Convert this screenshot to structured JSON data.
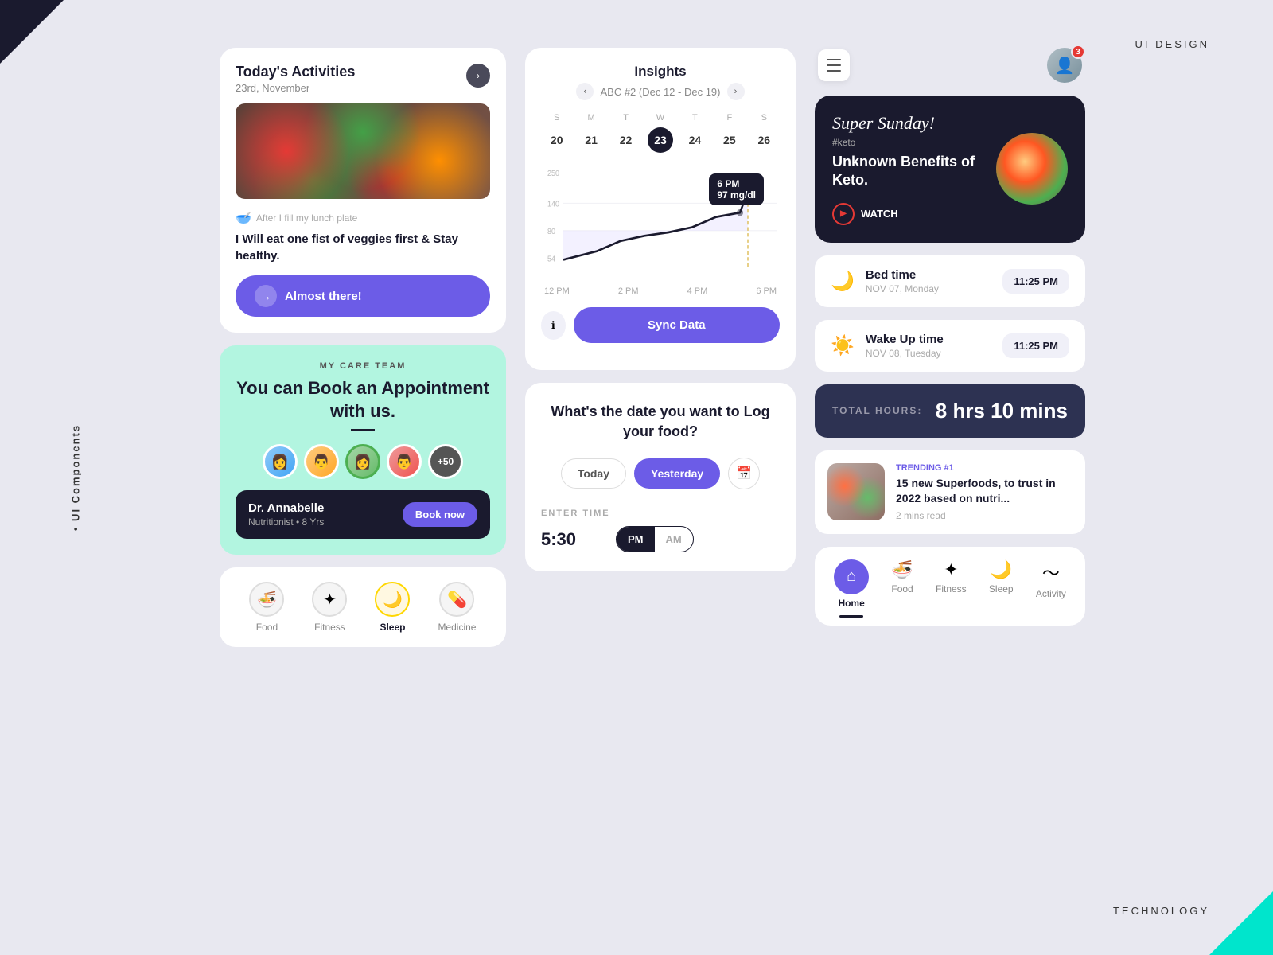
{
  "labels": {
    "ui_design": "UI DESIGN",
    "technology": "TECHNOLOGY",
    "ui_components": "• UI Components"
  },
  "activities": {
    "title": "Today's Activities",
    "date": "23rd, November",
    "meal_subtitle": "After I fill my lunch plate",
    "meal_text": "I Will eat one fist of veggies first & Stay healthy.",
    "cta_label": "Almost there!"
  },
  "care_team": {
    "label": "MY CARE TEAM",
    "title": "You can Book an Appointment with us.",
    "doctor_name": "Dr. Annabelle",
    "doctor_details": "Nutritionist  •  8 Yrs",
    "book_label": "Book now",
    "avatar_count": "+50"
  },
  "bottom_nav": {
    "items": [
      {
        "label": "Food",
        "icon": "🍜"
      },
      {
        "label": "Fitness",
        "icon": "✦"
      },
      {
        "label": "Sleep",
        "icon": "☀️",
        "active": true
      },
      {
        "label": "Medicine",
        "icon": "💊"
      }
    ]
  },
  "insights": {
    "title": "Insights",
    "range": "ABC #2 (Dec 12 - Dec 19)",
    "days_of_week": [
      "S",
      "M",
      "T",
      "W",
      "T",
      "F",
      "S"
    ],
    "dates": [
      "20",
      "21",
      "22",
      "23",
      "24",
      "25",
      "26"
    ],
    "active_date": "23",
    "y_labels": [
      "250",
      "140",
      "80",
      "54"
    ],
    "x_labels": [
      "12 PM",
      "2 PM",
      "4 PM",
      "6 PM"
    ],
    "tooltip_time": "6 PM",
    "tooltip_value": "97 mg/dl",
    "sync_label": "Sync Data"
  },
  "food_log": {
    "title": "What's the date you want to Log your food?",
    "btn_today": "Today",
    "btn_yesterday": "Yesterday",
    "enter_time_label": "ENTER TIME",
    "time_value": "5:30",
    "pm_label": "PM",
    "am_label": "AM"
  },
  "right": {
    "badge_count": "3",
    "video": {
      "super_sunday": "Super Sunday!",
      "tag": "#keto",
      "title": "Unknown Benefits of Keto.",
      "watch_label": "WATCH"
    },
    "sleep": {
      "title": "Bed time",
      "date": "NOV 07, Monday",
      "time": "11:25 PM"
    },
    "wake": {
      "title": "Wake Up time",
      "date": "NOV 08, Tuesday",
      "time": "11:25 PM"
    },
    "total": {
      "label": "TOTAL HOURS:",
      "value": "8 hrs 10 mins"
    },
    "article": {
      "trending": "TRENDING #1",
      "title": "15 new Superfoods, to trust in 2022 based on nutri...",
      "read_time": "2 mins read"
    },
    "app_nav": [
      {
        "label": "Home",
        "active": true
      },
      {
        "label": "Food"
      },
      {
        "label": "Fitness"
      },
      {
        "label": "Sleep"
      },
      {
        "label": "Activity"
      }
    ]
  }
}
